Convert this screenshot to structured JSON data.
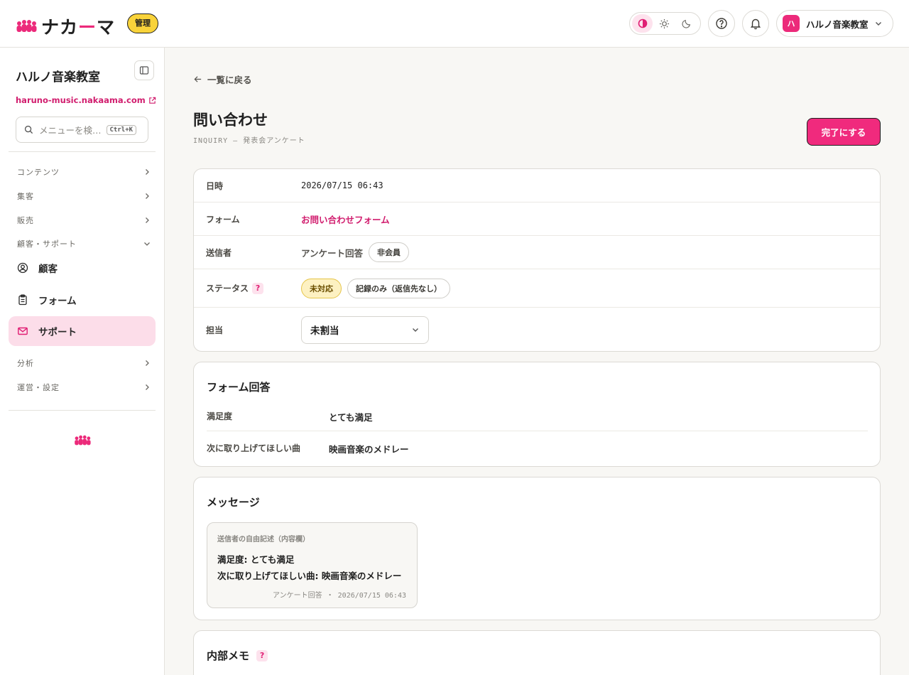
{
  "header": {
    "logo_text_a": "ナカ",
    "logo_text_dash": "ー",
    "logo_text_b": "マ",
    "admin_badge": "管理",
    "theme_icons": [
      "contrast-icon",
      "sun-icon",
      "moon-icon"
    ],
    "help_icon": "help-icon",
    "bell_icon": "bell-icon",
    "school_avatar": "ハ",
    "school_name": "ハルノ音楽教室"
  },
  "sidebar": {
    "title": "ハルノ音楽教室",
    "url": "haruno-music.nakaama.com",
    "search_placeholder": "メニューを検…",
    "search_shortcut": "Ctrl+K",
    "groups": {
      "contents": "コンテンツ",
      "marketing": "集客",
      "sales": "販売",
      "customer_support": "顧客・サポート",
      "analytics": "分析",
      "operations": "運営・設定"
    },
    "items": {
      "customers": "顧客",
      "forms": "フォーム",
      "support": "サポート"
    }
  },
  "page": {
    "back_label": "一覧に戻る",
    "title": "問い合わせ",
    "subtitle": "INQUIRY — 発表会アンケート",
    "done_button": "完了にする"
  },
  "details": {
    "datetime_label": "日時",
    "datetime_value": "2026/07/15 06:43",
    "form_label": "フォーム",
    "form_value": "お問い合わせフォーム",
    "sender_label": "送信者",
    "sender_value": "アンケート回答",
    "sender_badge": "非会員",
    "status_label": "ステータス",
    "status_badge_1": "未対応",
    "status_badge_2": "記録のみ（返信先なし）",
    "assignee_label": "担当",
    "assignee_value": "未割当"
  },
  "form_answers": {
    "title": "フォーム回答",
    "rows": [
      {
        "key": "満足度",
        "value": "とても満足"
      },
      {
        "key": "次に取り上げてほしい曲",
        "value": "映画音楽のメドレー"
      }
    ]
  },
  "message": {
    "title": "メッセージ",
    "caption": "送信者の自由記述（内容欄）",
    "line1": "満足度: とても満足",
    "line2": "次に取り上げてほしい曲: 映画音楽のメドレー",
    "meta": "アンケート回答 ・ 2026/07/15 06:43"
  },
  "memo": {
    "title": "内部メモ"
  },
  "colors": {
    "accent": "#f02a7d",
    "accent_light": "#fcdde9",
    "badge_yellow": "#f9d33a"
  }
}
